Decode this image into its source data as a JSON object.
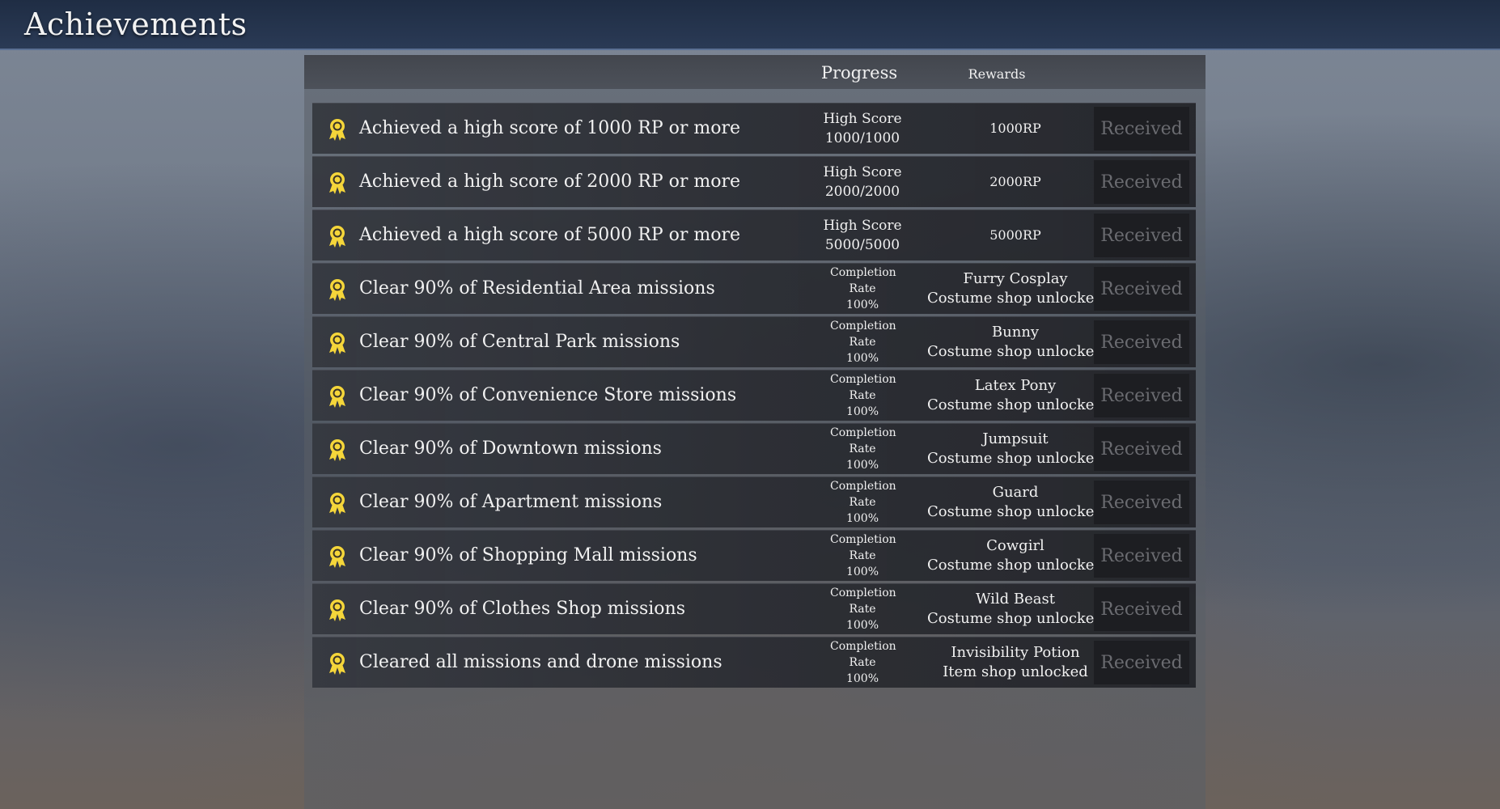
{
  "header": {
    "title": "Achievements"
  },
  "columns": {
    "progress": "Progress",
    "rewards": "Rewards"
  },
  "colors": {
    "badge": "#f5d63a",
    "topbar": "#24344e"
  },
  "achievements": [
    {
      "title": "Achieved a high score of 1000 RP or more",
      "progress_label": "High Score",
      "progress_value": "1000/1000",
      "reward_line1": "1000RP",
      "reward_line2": "",
      "button": "Received"
    },
    {
      "title": "Achieved a high score of 2000 RP or more",
      "progress_label": "High Score",
      "progress_value": "2000/2000",
      "reward_line1": "2000RP",
      "reward_line2": "",
      "button": "Received"
    },
    {
      "title": "Achieved a high score of 5000 RP or more",
      "progress_label": "High Score",
      "progress_value": "5000/5000",
      "reward_line1": "5000RP",
      "reward_line2": "",
      "button": "Received"
    },
    {
      "title": "Clear 90% of Residential Area missions",
      "progress_label": "Completion Rate",
      "progress_value": "100%",
      "reward_line1": "Furry Cosplay",
      "reward_line2": "Costume shop unlocked",
      "button": "Received"
    },
    {
      "title": "Clear 90% of Central Park missions",
      "progress_label": "Completion Rate",
      "progress_value": "100%",
      "reward_line1": "Bunny",
      "reward_line2": "Costume shop unlocked",
      "button": "Received"
    },
    {
      "title": "Clear 90% of Convenience Store missions",
      "progress_label": "Completion Rate",
      "progress_value": "100%",
      "reward_line1": "Latex Pony",
      "reward_line2": "Costume shop unlocked",
      "button": "Received"
    },
    {
      "title": "Clear 90% of Downtown missions",
      "progress_label": "Completion Rate",
      "progress_value": "100%",
      "reward_line1": "Jumpsuit",
      "reward_line2": "Costume shop unlocked",
      "button": "Received"
    },
    {
      "title": "Clear 90% of Apartment missions",
      "progress_label": "Completion Rate",
      "progress_value": "100%",
      "reward_line1": "Guard",
      "reward_line2": "Costume shop unlocked",
      "button": "Received"
    },
    {
      "title": "Clear 90% of Shopping Mall missions",
      "progress_label": "Completion Rate",
      "progress_value": "100%",
      "reward_line1": "Cowgirl",
      "reward_line2": "Costume shop unlocked",
      "button": "Received"
    },
    {
      "title": "Clear 90% of Clothes Shop missions",
      "progress_label": "Completion Rate",
      "progress_value": "100%",
      "reward_line1": "Wild Beast",
      "reward_line2": "Costume shop unlocked",
      "button": "Received"
    },
    {
      "title": "Cleared all missions and drone missions",
      "progress_label": "Completion Rate",
      "progress_value": "100%",
      "reward_line1": "Invisibility Potion",
      "reward_line2": "Item shop unlocked",
      "button": "Received"
    }
  ]
}
